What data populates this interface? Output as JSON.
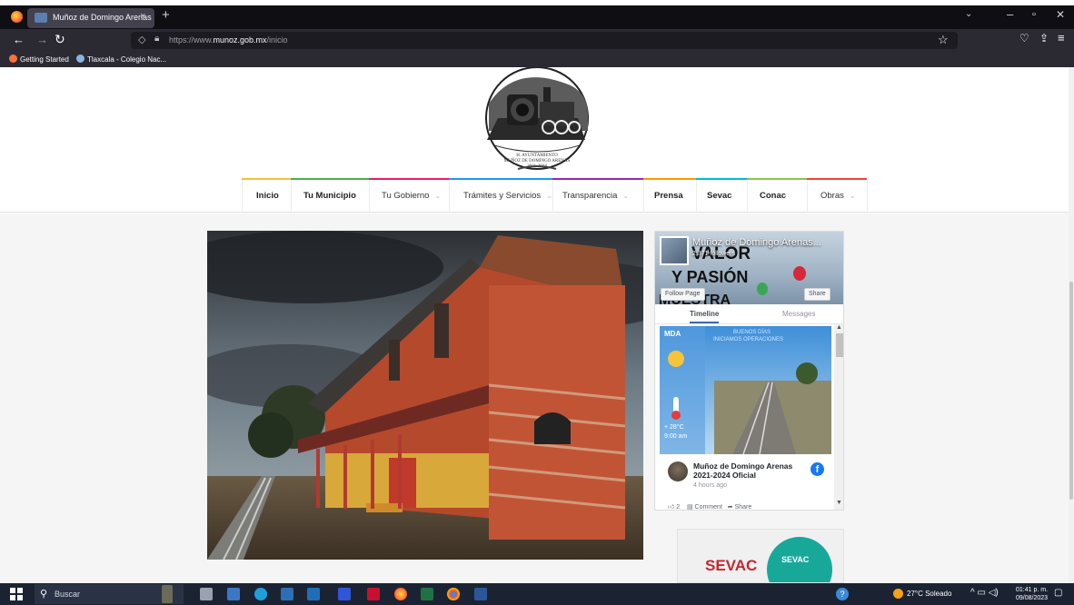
{
  "browser": {
    "tab_title": "Muñoz de Domingo Arenas",
    "tab_close": "×",
    "new_tab": "+",
    "url_prefix": "https://www.",
    "url_host": "munoz.gob.mx",
    "url_path": "/inicio",
    "bookmarks": [
      "Getting Started",
      "Tlaxcala - Colegio Nac..."
    ]
  },
  "header": {
    "logo_line1": "H. AYUNTAMIENTO",
    "logo_line2": "MUÑOZ DE DOMINGO ARENAS",
    "logo_line3": "2021-2024"
  },
  "menu": {
    "items": [
      {
        "label": "Inicio",
        "dropdown": false
      },
      {
        "label": "Tu Municipio",
        "dropdown": false
      },
      {
        "label": "Tu Gobierno",
        "dropdown": true
      },
      {
        "label": "Trámites y Servicios",
        "dropdown": true
      },
      {
        "label": "Transparencia",
        "dropdown": true
      },
      {
        "label": "Prensa",
        "dropdown": false
      },
      {
        "label": "Sevac",
        "dropdown": false
      },
      {
        "label": "Conac",
        "dropdown": false
      },
      {
        "label": "Obras",
        "dropdown": true
      }
    ],
    "accent_colors": [
      "#f4c430",
      "#4caf50",
      "#e91e63",
      "#2196f3",
      "#9c27b0",
      "#ff9800",
      "#00bcd4",
      "#8bc34a",
      "#f44336"
    ]
  },
  "facebook": {
    "page_name": "Muñoz de Domingo Arenas...",
    "followers": "2,371 followers",
    "cover_line1": "VALOR",
    "cover_line2": "Y PASIÓN",
    "cover_line3": "MUESTRA",
    "follow_label": "Follow Page",
    "share_label": "Share",
    "tab_timeline": "Timeline",
    "tab_messages": "Messages",
    "post_banner": "BUENOS DÍAS",
    "post_banner2": "INICIAMOS OPERACIONES",
    "post_logo": "MDA",
    "post_temp": "+ 28°C",
    "post_time_of_day": "9:00 am",
    "post_author": "Muñoz de Domingo Arenas 2021-2024 Oficial",
    "post_age": "4 hours ago",
    "post_likes": "2",
    "comment_label": "Comment",
    "share_action": "Share"
  },
  "sevac": {
    "label": "SEVAC",
    "mini": "SEVAC"
  },
  "taskbar": {
    "search_placeholder": "Buscar",
    "weather": "27°C Soleado",
    "time": "01:41 p. m.",
    "date": "09/08/2023"
  }
}
